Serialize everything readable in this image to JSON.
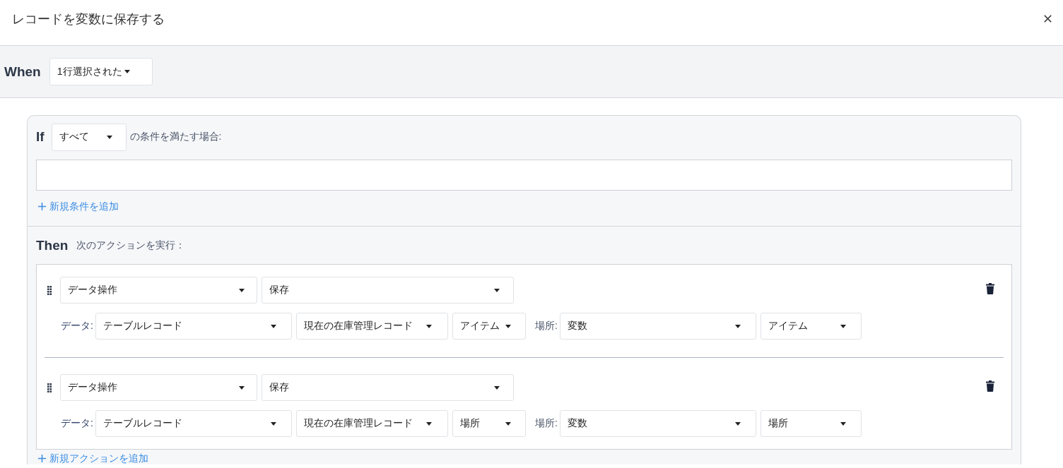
{
  "dialog": {
    "title": "レコードを変数に保存する"
  },
  "when": {
    "label": "When",
    "trigger": "1行選択された"
  },
  "if": {
    "label": "If",
    "match": "すべて",
    "suffix": "の条件を満たす場合:",
    "add_condition": "新規条件を追加"
  },
  "then": {
    "label": "Then",
    "caption": "次のアクションを実行：",
    "actions": [
      {
        "category": "データ操作",
        "operation": "保存",
        "data_label": "データ:",
        "source": "テーブルレコード",
        "table": "現在の在庫管理レコード",
        "field": "アイテム",
        "target_label": "場所:",
        "target": "変数",
        "variable": "アイテム"
      },
      {
        "category": "データ操作",
        "operation": "保存",
        "data_label": "データ:",
        "source": "テーブルレコード",
        "table": "現在の在庫管理レコード",
        "field": "場所",
        "target_label": "場所:",
        "target": "変数",
        "variable": "場所"
      }
    ],
    "add_action": "新規アクションを追加"
  }
}
